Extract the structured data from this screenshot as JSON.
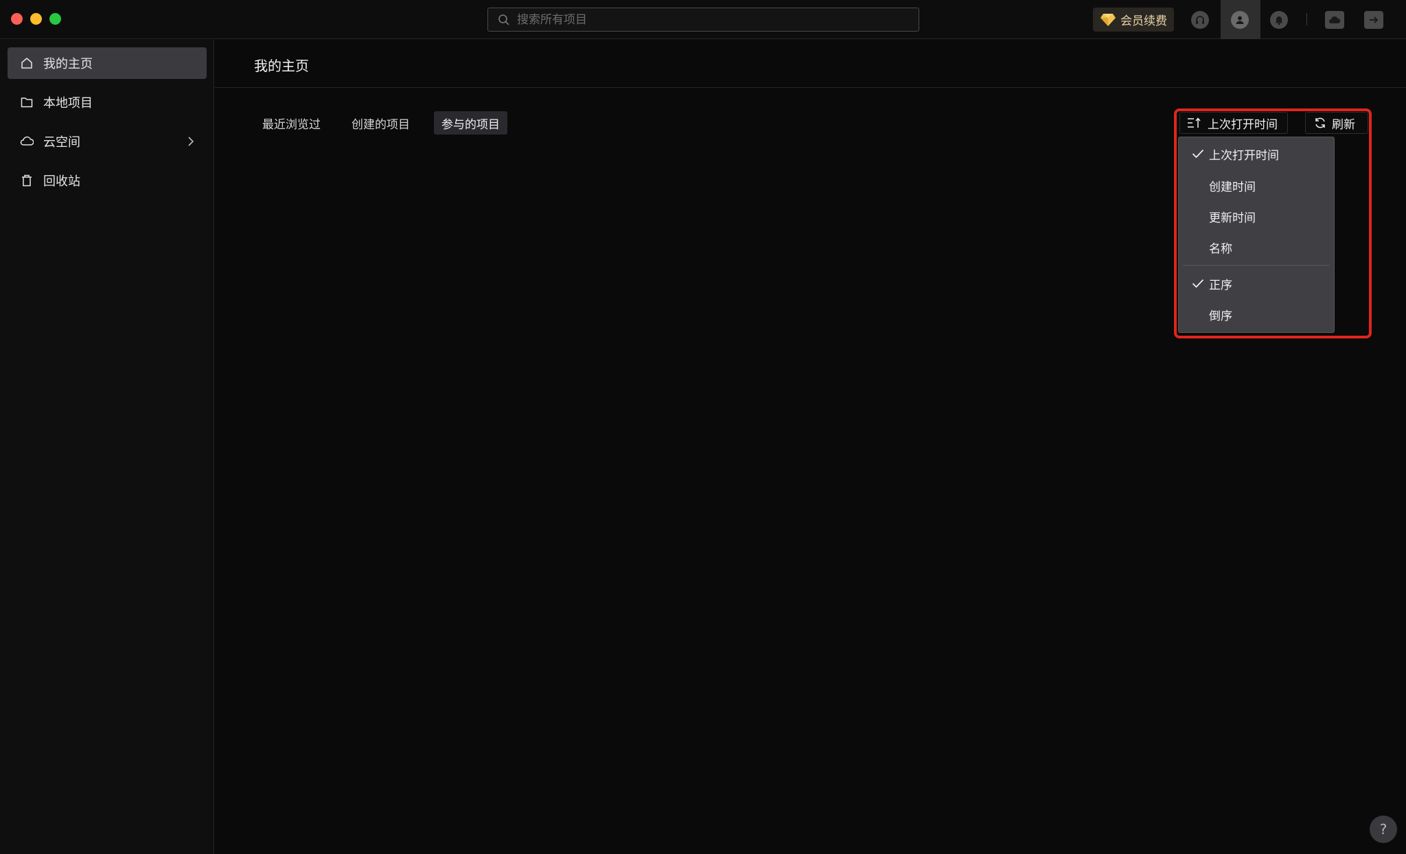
{
  "titlebar": {
    "search_placeholder": "搜索所有项目",
    "vip_label": "会员续费",
    "icons": [
      "headset-icon",
      "user-avatar-icon",
      "bell-icon",
      "cloud-box-icon",
      "exit-icon"
    ]
  },
  "sidebar": {
    "items": [
      {
        "label": "我的主页",
        "icon": "home-icon",
        "active": true
      },
      {
        "label": "本地项目",
        "icon": "folder-icon",
        "active": false
      },
      {
        "label": "云空间",
        "icon": "cloud-icon",
        "active": false,
        "has_submenu": true
      },
      {
        "label": "回收站",
        "icon": "trash-icon",
        "active": false
      }
    ]
  },
  "main": {
    "title": "我的主页",
    "tabs": [
      {
        "label": "最近浏览过",
        "active": false
      },
      {
        "label": "创建的项目",
        "active": false
      },
      {
        "label": "参与的项目",
        "active": true
      }
    ],
    "sort_button_label": "上次打开时间",
    "refresh_button_label": "刷新",
    "sort_menu": {
      "fields": [
        {
          "label": "上次打开时间",
          "checked": true
        },
        {
          "label": "创建时间",
          "checked": false
        },
        {
          "label": "更新时间",
          "checked": false
        },
        {
          "label": "名称",
          "checked": false
        }
      ],
      "orders": [
        {
          "label": "正序",
          "checked": true
        },
        {
          "label": "倒序",
          "checked": false
        }
      ]
    }
  },
  "help_label": "?",
  "colors": {
    "background": "#0a0a0a",
    "sidebar_active": "#3b3b3f",
    "vip_text": "#e8d3a8",
    "highlight_border": "#e0251d",
    "dropdown_bg": "#404044"
  }
}
